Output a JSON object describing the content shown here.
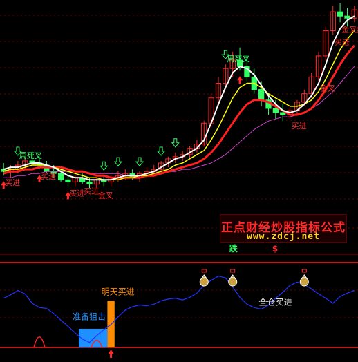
{
  "chart_data": [
    {
      "type": "candlestick",
      "panel": "main",
      "grid": true,
      "colors": {
        "up": "#ff2a2a",
        "down": "#33ff66",
        "ma_white": "#ffffff",
        "ma_yellow": "#ffff00",
        "ma_red": "#ff2020",
        "ma_magenta": "#cc44cc"
      },
      "ylim": [
        0,
        100
      ],
      "candles": [
        [
          22,
          25,
          19,
          21
        ],
        [
          21,
          24,
          18,
          22
        ],
        [
          22,
          26,
          20,
          24
        ],
        [
          24,
          28,
          22,
          26
        ],
        [
          26,
          31,
          24,
          25
        ],
        [
          25,
          28,
          22,
          24
        ],
        [
          24,
          26,
          20,
          21
        ],
        [
          21,
          24,
          18,
          20
        ],
        [
          20,
          22,
          16,
          17
        ],
        [
          17,
          20,
          14,
          16
        ],
        [
          16,
          19,
          14,
          18
        ],
        [
          18,
          20,
          15,
          16
        ],
        [
          16,
          18,
          13,
          15
        ],
        [
          15,
          18,
          13,
          17
        ],
        [
          17,
          19,
          14,
          16
        ],
        [
          16,
          19,
          14,
          18
        ],
        [
          18,
          21,
          16,
          19
        ],
        [
          19,
          22,
          17,
          20
        ],
        [
          20,
          22,
          17,
          18
        ],
        [
          18,
          21,
          16,
          20
        ],
        [
          20,
          23,
          18,
          21
        ],
        [
          21,
          24,
          19,
          22
        ],
        [
          22,
          26,
          20,
          25
        ],
        [
          25,
          28,
          23,
          27
        ],
        [
          27,
          30,
          25,
          28
        ],
        [
          28,
          31,
          26,
          29
        ],
        [
          29,
          33,
          27,
          32
        ],
        [
          32,
          36,
          30,
          34
        ],
        [
          34,
          45,
          33,
          44
        ],
        [
          44,
          58,
          42,
          56
        ],
        [
          56,
          66,
          52,
          63
        ],
        [
          63,
          72,
          60,
          70
        ],
        [
          70,
          78,
          66,
          74
        ],
        [
          74,
          80,
          69,
          71
        ],
        [
          71,
          76,
          64,
          66
        ],
        [
          66,
          70,
          58,
          60
        ],
        [
          60,
          64,
          52,
          55
        ],
        [
          55,
          58,
          48,
          51
        ],
        [
          51,
          55,
          46,
          49
        ],
        [
          49,
          53,
          45,
          48
        ],
        [
          48,
          52,
          46,
          50
        ],
        [
          50,
          55,
          48,
          54
        ],
        [
          54,
          60,
          52,
          58
        ],
        [
          58,
          68,
          56,
          66
        ],
        [
          66,
          78,
          64,
          76
        ],
        [
          76,
          90,
          74,
          88
        ],
        [
          88,
          100,
          86,
          97
        ],
        [
          97,
          101,
          92,
          95
        ],
        [
          95,
          99,
          90,
          94
        ],
        [
          94,
          100,
          92,
          98
        ]
      ],
      "lines": {
        "white": [
          22,
          23,
          23,
          24,
          25,
          25,
          24,
          23,
          21,
          19,
          18,
          18,
          17,
          17,
          17,
          17,
          18,
          19,
          19,
          19,
          20,
          21,
          23,
          25,
          27,
          28,
          30,
          32,
          36,
          44,
          53,
          61,
          68,
          71,
          70,
          67,
          62,
          57,
          53,
          50,
          49,
          50,
          53,
          57,
          63,
          72,
          82,
          89,
          93,
          95
        ],
        "yellow": [
          21,
          22,
          22,
          23,
          24,
          24,
          24,
          23,
          22,
          21,
          20,
          19,
          18,
          18,
          17,
          17,
          17,
          18,
          18,
          19,
          19,
          20,
          21,
          22,
          24,
          25,
          27,
          29,
          31,
          36,
          42,
          49,
          56,
          61,
          63,
          63,
          61,
          58,
          56,
          54,
          52,
          52,
          53,
          55,
          59,
          65,
          72,
          79,
          84,
          88
        ],
        "red": [
          20,
          21,
          21,
          22,
          22,
          23,
          23,
          23,
          23,
          22,
          21,
          21,
          20,
          19,
          19,
          18,
          18,
          18,
          18,
          18,
          19,
          19,
          20,
          21,
          22,
          23,
          24,
          25,
          27,
          30,
          34,
          39,
          44,
          49,
          53,
          55,
          55,
          54,
          52,
          50,
          48,
          48,
          49,
          51,
          55,
          60,
          66,
          72,
          77,
          81
        ],
        "magenta": [
          18,
          18,
          19,
          19,
          20,
          20,
          21,
          21,
          21,
          21,
          21,
          21,
          20,
          20,
          20,
          20,
          20,
          19,
          19,
          19,
          19,
          20,
          20,
          21,
          21,
          22,
          22,
          23,
          24,
          25,
          27,
          29,
          32,
          35,
          38,
          41,
          43,
          45,
          46,
          47,
          47,
          48,
          49,
          51,
          53,
          56,
          59,
          63,
          67,
          71
        ]
      },
      "signals": [
        {
          "x": 0,
          "text": "买进",
          "color": "#ff2a2a",
          "marker": "up-arrow"
        },
        {
          "x": 2,
          "text": "周死叉",
          "color": "#33ff66",
          "marker": "down-arrow"
        },
        {
          "x": 5,
          "text": "买进",
          "color": "#ff2a2a",
          "marker": "up-arrow"
        },
        {
          "x": 9,
          "text": "买进",
          "color": "#ff2a2a",
          "marker": "up-arrow"
        },
        {
          "x": 11,
          "text": "买进",
          "color": "#ff2a2a",
          "marker": "none"
        },
        {
          "x": 13,
          "text": "金叉",
          "color": "#ff2a2a",
          "marker": "none"
        },
        {
          "x": 14,
          "text": "",
          "color": "#33ff66",
          "marker": "down-arrow"
        },
        {
          "x": 16,
          "text": "",
          "color": "#33ff66",
          "marker": "down-arrow"
        },
        {
          "x": 19,
          "text": "",
          "color": "#33ff66",
          "marker": "down-arrow"
        },
        {
          "x": 22,
          "text": "",
          "color": "#33ff66",
          "marker": "down-arrow"
        },
        {
          "x": 24,
          "text": "",
          "color": "#33ff66",
          "marker": "down-arrow"
        },
        {
          "x": 31,
          "text": "周死叉",
          "color": "#33ff66",
          "marker": "down-arrow"
        },
        {
          "x": 33,
          "text": "",
          "color": "#ff2a2a",
          "marker": "up-arrow"
        },
        {
          "x": 40,
          "text": "买进",
          "color": "#ff2a2a",
          "marker": "none"
        },
        {
          "x": 44,
          "text": "金叉",
          "color": "#ff2a2a",
          "marker": "none"
        },
        {
          "x": 46,
          "text": "买进",
          "color": "#ff2a2a",
          "marker": "none"
        },
        {
          "x": 47,
          "text": "金叉",
          "color": "#ff2a2a",
          "marker": "none"
        },
        {
          "x": 49,
          "text": "金叉",
          "color": "#ff2a2a",
          "marker": "none"
        }
      ]
    },
    {
      "type": "line",
      "panel": "indicator",
      "ylim": [
        0,
        100
      ],
      "line_color": "#2233ff",
      "series": [
        {
          "values": [
            58,
            62,
            67,
            63,
            52,
            47,
            46,
            40,
            32,
            25,
            17,
            10,
            6,
            14,
            21,
            27,
            36,
            44,
            48,
            50,
            49,
            51,
            55,
            57,
            58,
            56,
            59,
            64,
            73,
            79,
            84,
            82,
            71,
            59,
            51,
            47,
            45,
            50,
            58,
            65,
            73,
            77,
            74,
            69,
            63,
            58,
            52,
            60,
            64,
            67
          ]
        }
      ],
      "reference_lines": [
        {
          "y": 100,
          "color": "#ff2020"
        },
        {
          "y": 0,
          "color": "#ff2020"
        }
      ],
      "bars": [
        {
          "x": 11,
          "width": 3,
          "value": 22,
          "color": "#1e90ff"
        },
        {
          "x": 14,
          "width": 1,
          "value": 22,
          "color": "#1e90ff"
        },
        {
          "x": 15,
          "width": 1,
          "value": 55,
          "color": "#ff8c00"
        }
      ],
      "peaks": [
        {
          "x": 5,
          "value": 20,
          "color": "#ff2020"
        },
        {
          "x": 13,
          "value": 12,
          "color": "#ff2020"
        }
      ],
      "annotations": [
        {
          "x": 11,
          "y": 33,
          "text": "准备狙击",
          "color": "#1e90ff"
        },
        {
          "x": 15,
          "y": 62,
          "text": "明天买进",
          "color": "#ff8c00"
        },
        {
          "x": 37,
          "y": 50,
          "text": "全仓买进",
          "color": "#ffffff"
        }
      ],
      "money_bags": [
        {
          "x": 28
        },
        {
          "x": 32
        },
        {
          "x": 42
        }
      ],
      "labels": [
        {
          "x": 32,
          "text": "跌",
          "color": "#33ff66"
        },
        {
          "x": 38,
          "text": "$",
          "color": "#ff2a2a"
        }
      ]
    }
  ],
  "watermark": {
    "title": "正点财经炒股指标公式",
    "url": "www.zdcj.net"
  }
}
